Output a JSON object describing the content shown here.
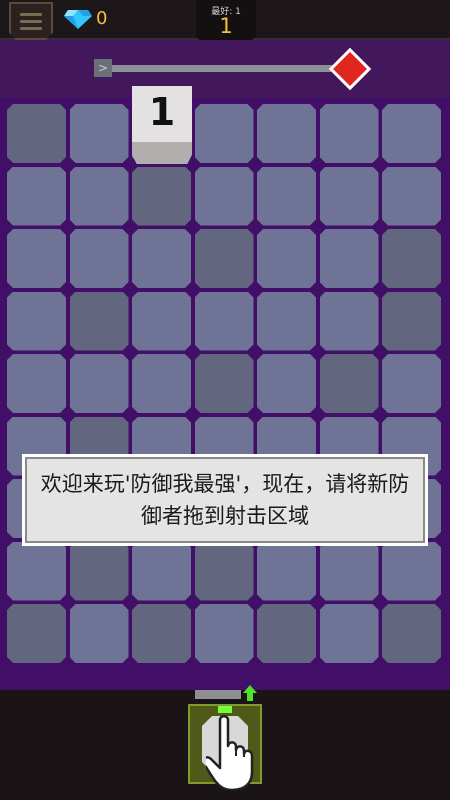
{
  "header": {
    "menu_icon": "hamburger-menu-icon",
    "gem_icon": "diamond-icon",
    "gem_count": "0",
    "best_label": "最好: 1",
    "best_value": "1"
  },
  "progress": {
    "start_icon": "chevron-right-icon",
    "start_glyph": ">",
    "end_icon": "red-diamond-goal-icon",
    "fraction": 0.0
  },
  "board": {
    "columns": 7,
    "rows": 9,
    "defender_value": "1"
  },
  "dialog": {
    "text": "欢迎来玩'防御我最强'，现在，请将新防御者拖到射击区域"
  },
  "bottom": {
    "upgrade_icon": "green-up-arrow-icon",
    "hand_icon": "pointing-hand-icon"
  },
  "colors": {
    "board_bg": "#410f67",
    "cell": "#6f7396",
    "cell_dark": "#62667f",
    "accent_gold": "#f2c23a",
    "goal_red": "#e0271f",
    "slot_green": "#7f9a2d"
  }
}
